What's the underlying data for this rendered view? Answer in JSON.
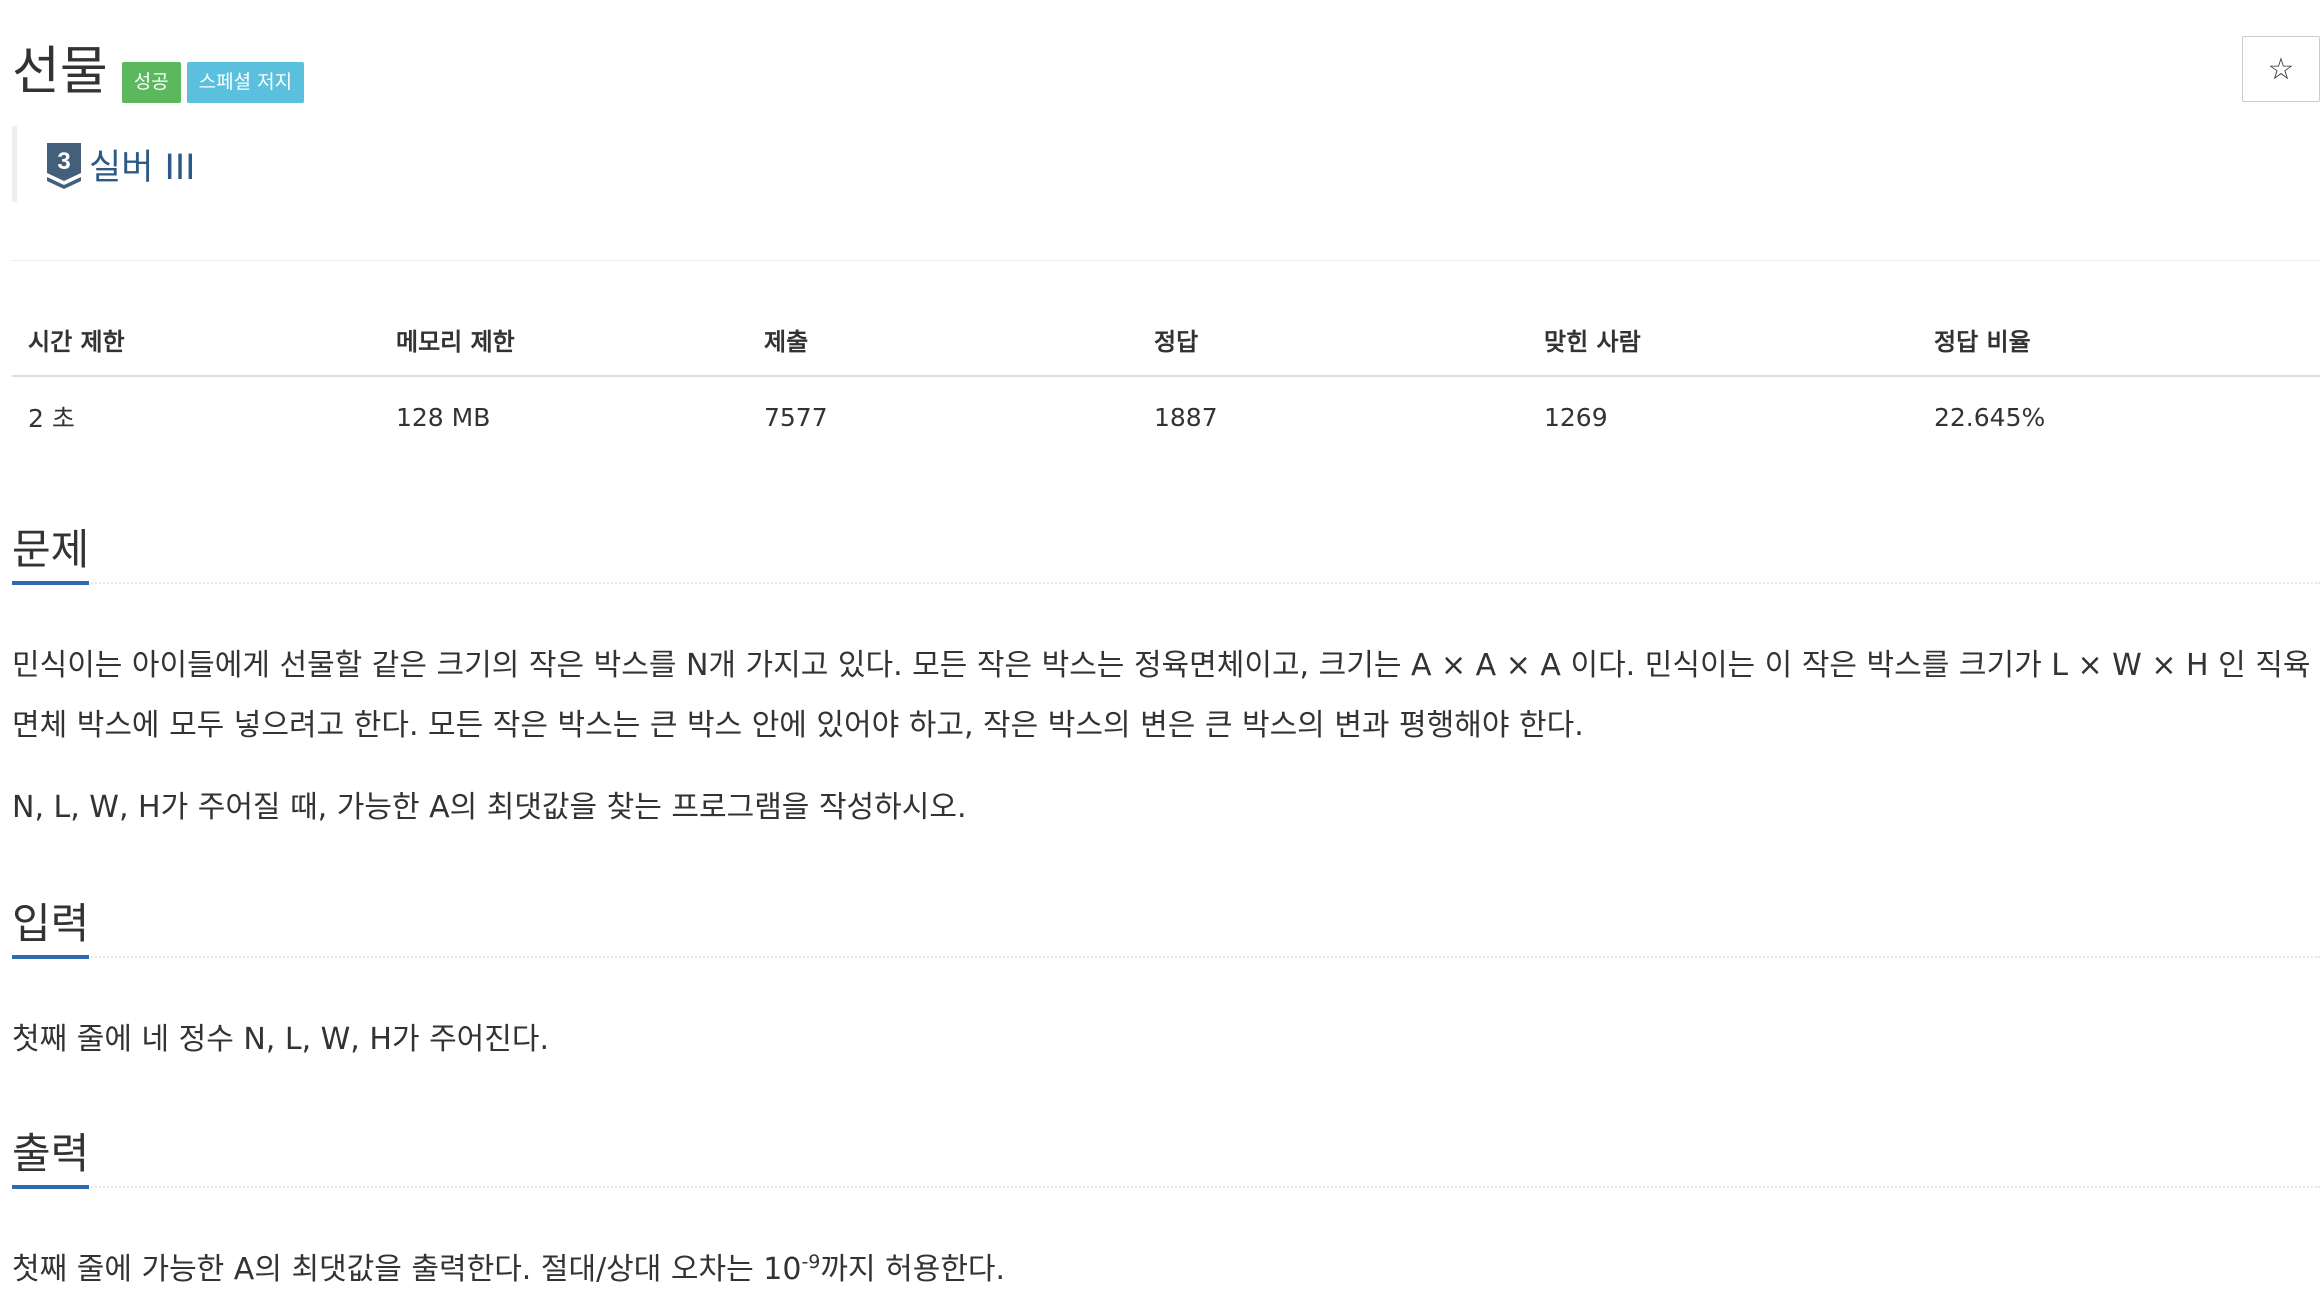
{
  "problem": {
    "title": "선물",
    "labels": {
      "success": "성공",
      "special_judge": "스페셜 저지"
    },
    "star": "☆",
    "tier": {
      "number": "3",
      "name": "실버 III",
      "color": "#435f7a"
    }
  },
  "info_table": {
    "headers": [
      "시간 제한",
      "메모리 제한",
      "제출",
      "정답",
      "맞힌 사람",
      "정답 비율"
    ],
    "row": [
      "2 초",
      "128 MB",
      "7577",
      "1887",
      "1269",
      "22.645%"
    ]
  },
  "sections": {
    "description": {
      "heading": "문제",
      "paragraph1": "민식이는 아이들에게 선물할 같은 크기의 작은 박스를 N개 가지고 있다. 모든 작은 박스는 정육면체이고, 크기는 A × A × A 이다. 민식이는 이 작은 박스를 크기가 L × W × H 인 직육면체 박스에 모두 넣으려고 한다. 모든 작은 박스는 큰 박스 안에 있어야 하고, 작은 박스의 변은 큰 박스의 변과 평행해야 한다.",
      "paragraph2": "N, L, W, H가 주어질 때, 가능한 A의 최댓값을 찾는 프로그램을 작성하시오."
    },
    "input": {
      "heading": "입력",
      "paragraph": "첫째 줄에 네 정수 N, L, W, H가 주어진다."
    },
    "output": {
      "heading": "출력",
      "text_before": "첫째 줄에 가능한 A의 최댓값을 출력한다. 절대/상대 오차는 10",
      "exponent": "-9",
      "text_after": "까지 허용한다."
    }
  },
  "colors": {
    "success": "#5cb85c",
    "info": "#5bc0de",
    "accent": "#2b6cb0",
    "tier_text": "#2c5a85"
  }
}
